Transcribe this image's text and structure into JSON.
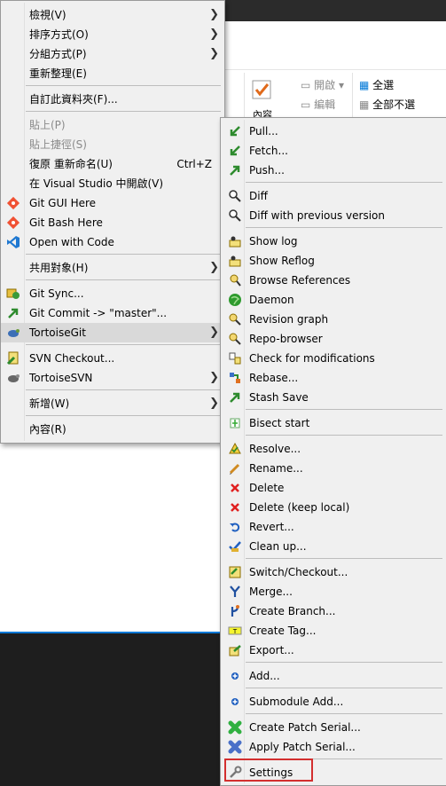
{
  "ribbon": {
    "properties": "內容",
    "open": "開啟",
    "edit": "編輯",
    "select_all": "全選",
    "select_none": "全部不選"
  },
  "main_menu": [
    {
      "label": "檢視(V)",
      "submenu": true
    },
    {
      "label": "排序方式(O)",
      "submenu": true
    },
    {
      "label": "分組方式(P)",
      "submenu": true
    },
    {
      "label": "重新整理(E)"
    },
    {
      "label": "自訂此資料夾(F)..."
    },
    {
      "label": "貼上(P)",
      "disabled": true
    },
    {
      "label": "貼上捷徑(S)",
      "disabled": true
    },
    {
      "label": "復原 重新命名(U)",
      "shortcut": "Ctrl+Z"
    },
    {
      "label": "在 Visual Studio 中開啟(V)"
    },
    {
      "label": "Git GUI Here",
      "icon": "git-gui-icon"
    },
    {
      "label": "Git Bash Here",
      "icon": "git-bash-icon"
    },
    {
      "label": "Open with Code",
      "icon": "vscode-icon"
    },
    {
      "label": "共用對象(H)",
      "submenu": true
    },
    {
      "label": "Git Sync...",
      "icon": "git-sync-icon"
    },
    {
      "label": "Git Commit -> \"master\"...",
      "icon": "git-commit-icon"
    },
    {
      "label": "TortoiseGit",
      "icon": "tortoisegit-icon",
      "submenu": true,
      "highlighted": true
    },
    {
      "label": "SVN Checkout...",
      "icon": "svn-checkout-icon"
    },
    {
      "label": "TortoiseSVN",
      "icon": "tortoisesvn-icon",
      "submenu": true
    },
    {
      "label": "新增(W)",
      "submenu": true
    },
    {
      "label": "內容(R)"
    }
  ],
  "sub_menu": [
    {
      "label": "Pull...",
      "icon": "pull-icon"
    },
    {
      "label": "Fetch...",
      "icon": "fetch-icon"
    },
    {
      "label": "Push...",
      "icon": "push-icon"
    },
    {
      "label": "Diff",
      "icon": "diff-icon"
    },
    {
      "label": "Diff with previous version",
      "icon": "diff-previous-icon"
    },
    {
      "label": "Show log",
      "icon": "show-log-icon"
    },
    {
      "label": "Show Reflog",
      "icon": "show-reflog-icon"
    },
    {
      "label": "Browse References",
      "icon": "browse-references-icon"
    },
    {
      "label": "Daemon",
      "icon": "daemon-icon"
    },
    {
      "label": "Revision graph",
      "icon": "revision-graph-icon"
    },
    {
      "label": "Repo-browser",
      "icon": "repo-browser-icon"
    },
    {
      "label": "Check for modifications",
      "icon": "check-modifications-icon"
    },
    {
      "label": "Rebase...",
      "icon": "rebase-icon"
    },
    {
      "label": "Stash Save",
      "icon": "stash-save-icon"
    },
    {
      "label": "Bisect start",
      "icon": "bisect-start-icon"
    },
    {
      "label": "Resolve...",
      "icon": "resolve-icon"
    },
    {
      "label": "Rename...",
      "icon": "rename-icon"
    },
    {
      "label": "Delete",
      "icon": "delete-icon"
    },
    {
      "label": "Delete (keep local)",
      "icon": "delete-keep-local-icon"
    },
    {
      "label": "Revert...",
      "icon": "revert-icon"
    },
    {
      "label": "Clean up...",
      "icon": "clean-up-icon"
    },
    {
      "label": "Switch/Checkout...",
      "icon": "switch-checkout-icon"
    },
    {
      "label": "Merge...",
      "icon": "merge-icon"
    },
    {
      "label": "Create Branch...",
      "icon": "create-branch-icon"
    },
    {
      "label": "Create Tag...",
      "icon": "create-tag-icon"
    },
    {
      "label": "Export...",
      "icon": "export-icon"
    },
    {
      "label": "Add...",
      "icon": "add-icon"
    },
    {
      "label": "Submodule Add...",
      "icon": "submodule-add-icon"
    },
    {
      "label": "Create Patch Serial...",
      "icon": "create-patch-icon"
    },
    {
      "label": "Apply Patch Serial...",
      "icon": "apply-patch-icon"
    },
    {
      "label": "Settings",
      "icon": "settings-icon",
      "outlined": true
    }
  ],
  "colors": {
    "highlight_outline": "#d32f2f",
    "accent": "#0078d7"
  }
}
